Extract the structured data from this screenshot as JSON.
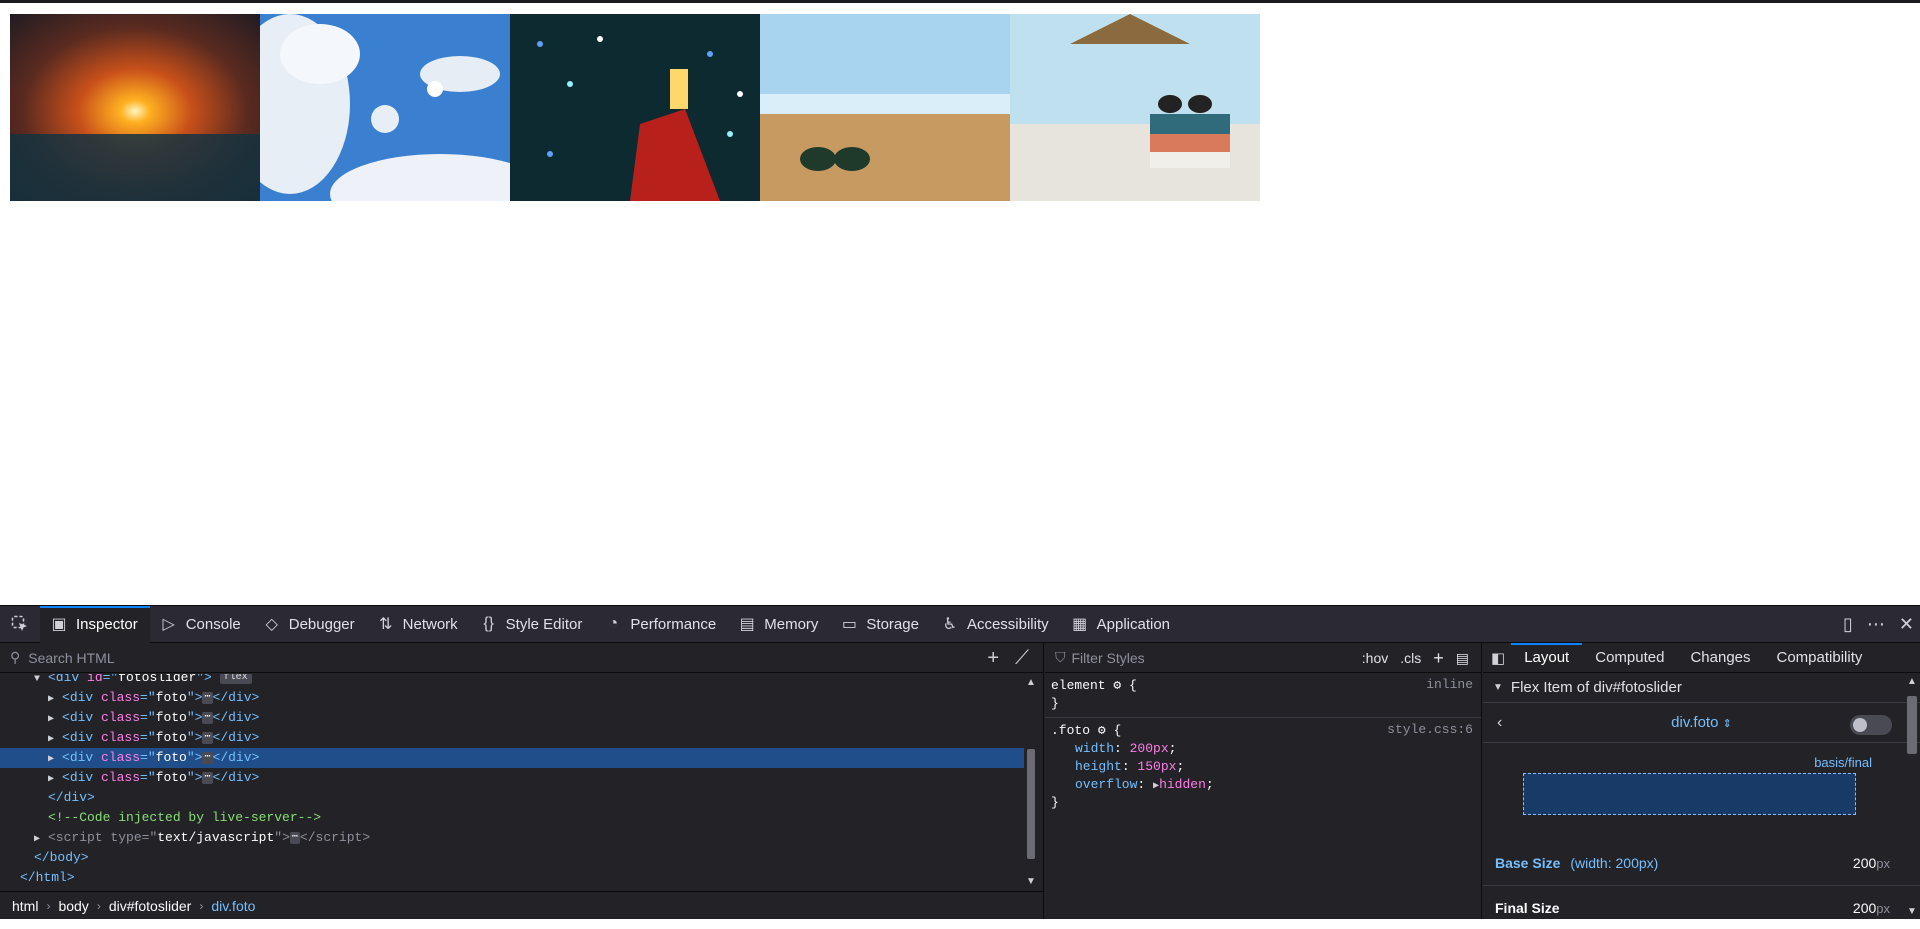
{
  "devtools": {
    "tabs": [
      {
        "label": "Inspector",
        "icon": "inspector-icon"
      },
      {
        "label": "Console",
        "icon": "console-icon"
      },
      {
        "label": "Debugger",
        "icon": "debugger-icon"
      },
      {
        "label": "Network",
        "icon": "network-icon"
      },
      {
        "label": "Style Editor",
        "icon": "style-editor-icon"
      },
      {
        "label": "Performance",
        "icon": "performance-icon"
      },
      {
        "label": "Memory",
        "icon": "memory-icon"
      },
      {
        "label": "Storage",
        "icon": "storage-icon"
      },
      {
        "label": "Accessibility",
        "icon": "accessibility-icon"
      },
      {
        "label": "Application",
        "icon": "application-icon"
      }
    ],
    "search_placeholder": "Search HTML",
    "markup": {
      "parent_id": "fotoslider",
      "flex_badge": "flex",
      "child_tag": "div",
      "child_class_attr": "class",
      "child_class": "foto",
      "close_div": "</div>",
      "comment": "<!--Code injected by live-server-->",
      "script_type": "text/javascript",
      "close_body": "</body>",
      "close_html": "</html>"
    },
    "breadcrumbs": [
      "html",
      "body",
      "div#fotoslider",
      "div.foto"
    ],
    "rules": {
      "filter_placeholder": "Filter Styles",
      "hov": ":hov",
      "cls": ".cls",
      "element_selector": "element",
      "element_source": "inline",
      "foto_selector": ".foto",
      "foto_source": "style.css:6",
      "props": [
        {
          "name": "width",
          "value": "200px"
        },
        {
          "name": "height",
          "value": "150px"
        },
        {
          "name": "overflow",
          "value": "hidden"
        }
      ]
    },
    "layout": {
      "tabs": [
        "Layout",
        "Computed",
        "Changes",
        "Compatibility"
      ],
      "section_title": "Flex Item of div#fotoslider",
      "selected_item": "div.foto",
      "basis_label": "basis/final",
      "base_size_label": "Base Size",
      "base_size_note": "(width: 200px)",
      "base_size_value": "200",
      "final_size_label": "Final Size",
      "final_size_value": "200",
      "unit": "px"
    }
  }
}
